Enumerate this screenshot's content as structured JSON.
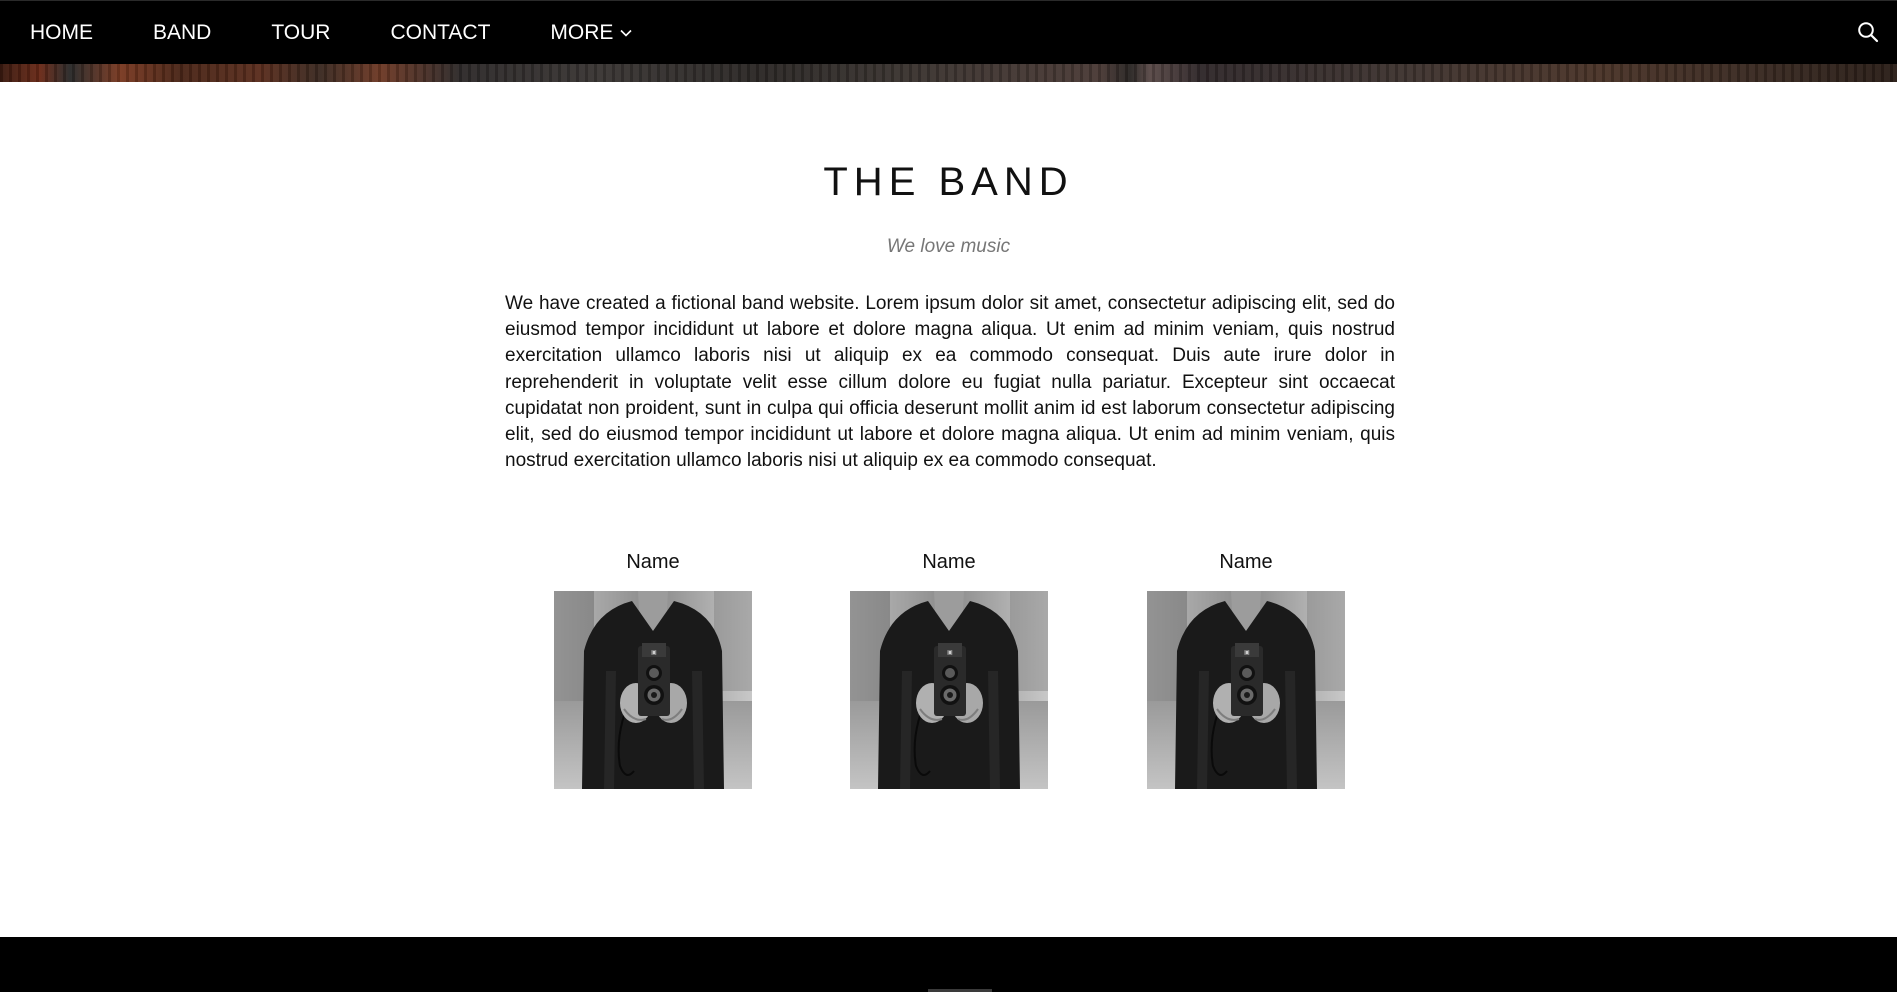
{
  "nav": {
    "items": [
      {
        "label": "HOME"
      },
      {
        "label": "BAND"
      },
      {
        "label": "TOUR"
      },
      {
        "label": "CONTACT"
      }
    ],
    "more_label": "MORE",
    "more_icon": "chevron-down-icon",
    "search_icon": "search-icon",
    "background": "#000000",
    "text_color": "#ffffff"
  },
  "band": {
    "title": "THE BAND",
    "subtitle": "We love music",
    "description": "We have created a fictional band website. Lorem ipsum dolor sit amet, consectetur adipiscing elit, sed do eiusmod tempor incididunt ut labore et dolore magna aliqua. Ut enim ad minim veniam, quis nostrud exercitation ullamco laboris nisi ut aliquip ex ea commodo consequat. Duis aute irure dolor in reprehenderit in voluptate velit esse cillum dolore eu fugiat nulla pariatur. Excepteur sint occaecat cupidatat non proident, sunt in culpa qui officia deserunt mollit anim id est laborum consectetur adipiscing elit, sed do eiusmod tempor incididunt ut labore et dolore magna aliqua. Ut enim ad minim veniam, quis nostrud exercitation ullamco laboris nisi ut aliquip ex ea commodo consequat.",
    "members": [
      {
        "name": "Name"
      },
      {
        "name": "Name"
      },
      {
        "name": "Name"
      }
    ]
  },
  "footer": {
    "background": "#000000"
  }
}
